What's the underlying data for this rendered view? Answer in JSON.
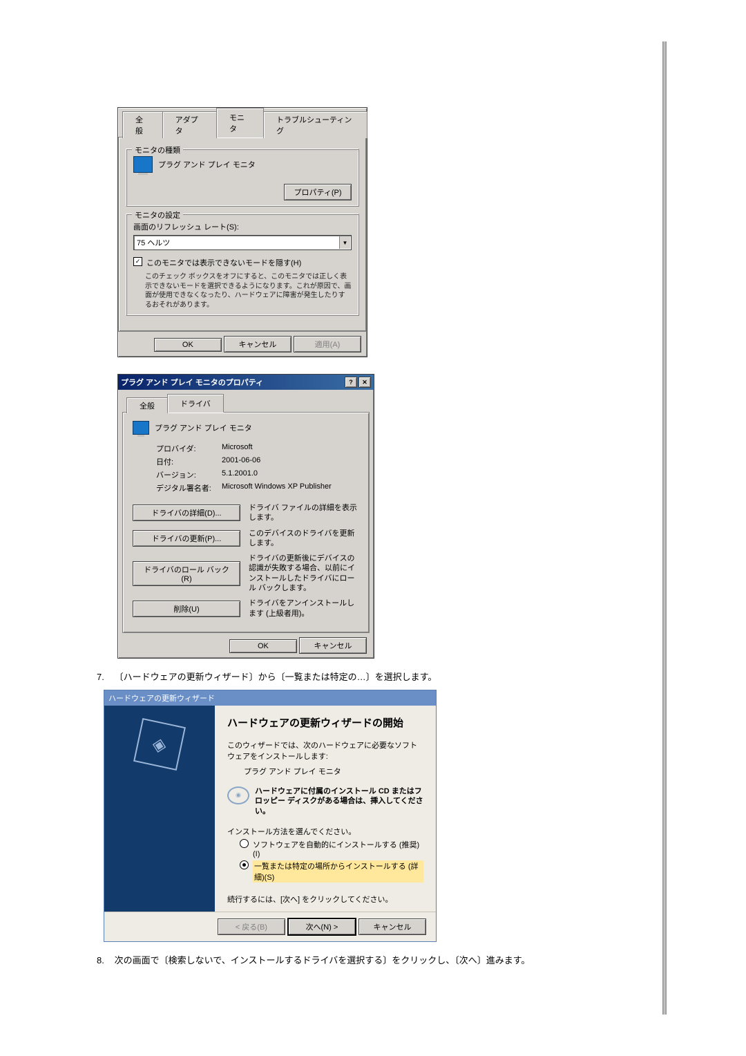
{
  "dialog1": {
    "tabs": [
      "全般",
      "アダプタ",
      "モニタ",
      "トラブルシューティング"
    ],
    "active_tab": 2,
    "monitor_type_group": "モニタの種類",
    "monitor_name": "プラグ アンド プレイ モニタ",
    "properties_btn": "プロパティ(P)",
    "monitor_settings_group": "モニタの設定",
    "refresh_label": "画面のリフレッシュ レート(S):",
    "refresh_value": "75 ヘルツ",
    "hide_modes_checkbox": "このモニタでは表示できないモードを隠す(H)",
    "hide_modes_note": "このチェック ボックスをオフにすると、このモニタでは正しく表示できないモードを選択できるようになります。これが原因で、画面が使用できなくなったり、ハードウェアに障害が発生したりするおそれがあります。",
    "ok": "OK",
    "cancel": "キャンセル",
    "apply": "適用(A)"
  },
  "dialog2": {
    "title": "プラグ アンド プレイ モニタのプロパティ",
    "tabs": [
      "全般",
      "ドライバ"
    ],
    "active_tab": 1,
    "device_name": "プラグ アンド プレイ モニタ",
    "provider_k": "プロバイダ:",
    "provider_v": "Microsoft",
    "date_k": "日付:",
    "date_v": "2001-06-06",
    "version_k": "バージョン:",
    "version_v": "5.1.2001.0",
    "signer_k": "デジタル署名者:",
    "signer_v": "Microsoft Windows XP Publisher",
    "btn_details": "ドライバの詳細(D)...",
    "txt_details": "ドライバ ファイルの詳細を表示します。",
    "btn_update": "ドライバの更新(P)...",
    "txt_update": "このデバイスのドライバを更新します。",
    "btn_rollback": "ドライバのロール バック(R)",
    "txt_rollback": "ドライバの更新後にデバイスの認識が失敗する場合、以前にインストールしたドライバにロール バックします。",
    "btn_uninstall": "削除(U)",
    "txt_uninstall": "ドライバをアンインストールします (上級者用)。",
    "ok": "OK",
    "cancel": "キャンセル"
  },
  "step7": {
    "num": "7.",
    "text": "〔ハードウェアの更新ウィザード〕から〔一覧または特定の…〕を選択します。"
  },
  "wizard": {
    "title": "ハードウェアの更新ウィザード",
    "heading": "ハードウェアの更新ウィザードの開始",
    "intro": "このウィザードでは、次のハードウェアに必要なソフトウェアをインストールします:",
    "device": "プラグ アンド プレイ モニタ",
    "cd_note": "ハードウェアに付属のインストール CD またはフロッピー ディスクがある場合は、挿入してください。",
    "choose": "インストール方法を選んでください。",
    "opt_auto": "ソフトウェアを自動的にインストールする (推奨)(I)",
    "opt_list": "一覧または特定の場所からインストールする (詳細)(S)",
    "continue": "続行するには、[次へ] をクリックしてください。",
    "back": "< 戻る(B)",
    "next": "次へ(N) >",
    "cancel": "キャンセル"
  },
  "step8": {
    "num": "8.",
    "text": "次の画面で〔検索しないで、インストールするドライバを選択する〕をクリックし、〔次へ〕進みます。"
  }
}
